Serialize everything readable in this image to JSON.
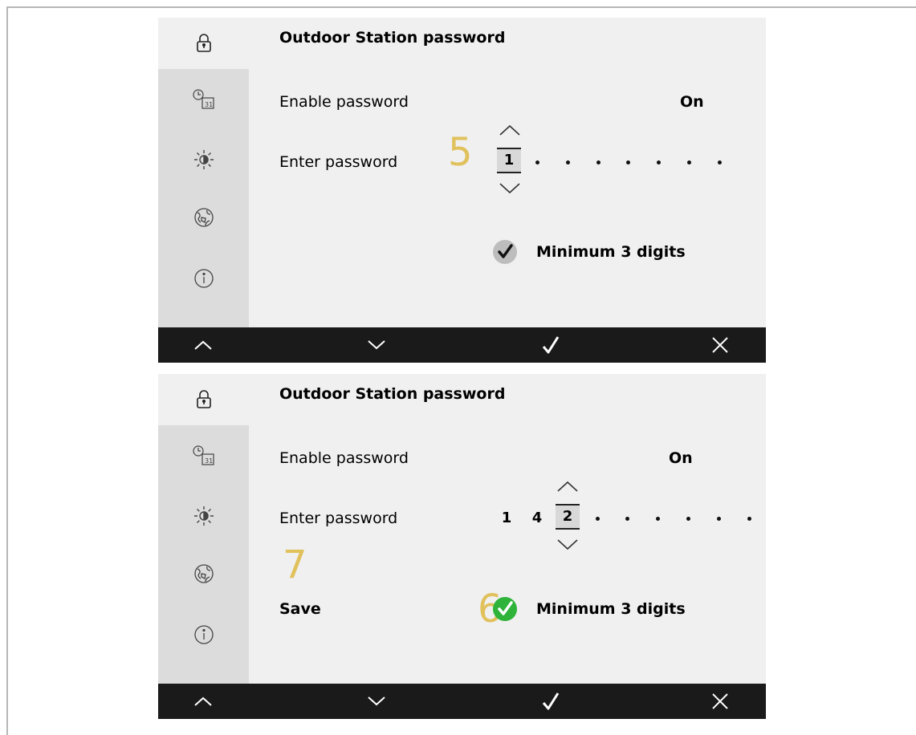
{
  "screens": [
    {
      "title": "Outdoor Station password",
      "enable_label": "Enable password",
      "enable_value": "On",
      "enter_label": "Enter password",
      "digits": [
        "1"
      ],
      "selected_digit_index": 0,
      "dot_count": 7,
      "check_label": "Minimum 3 digits",
      "check_state": "inactive",
      "annotations": [
        "5"
      ],
      "save_label": ""
    },
    {
      "title": "Outdoor Station password",
      "enable_label": "Enable password",
      "enable_value": "On",
      "enter_label": "Enter password",
      "digits": [
        "1",
        "4",
        "2"
      ],
      "selected_digit_index": 2,
      "dot_count": 6,
      "check_label": "Minimum 3 digits",
      "check_state": "active",
      "annotations": [
        "7",
        "6"
      ],
      "save_label": "Save"
    }
  ],
  "sidebar_icons": [
    "lock-icon",
    "clock-calendar-icon",
    "brightness-icon",
    "globe-icon",
    "info-icon"
  ],
  "bottom_bar_icons": [
    "chevron-up-icon",
    "chevron-down-icon",
    "check-icon",
    "close-icon"
  ],
  "colors": {
    "annotation": "#e0c15c",
    "check_active": "#2fb33a",
    "check_inactive": "#bdbdbd",
    "bar": "#1a1a1a"
  }
}
